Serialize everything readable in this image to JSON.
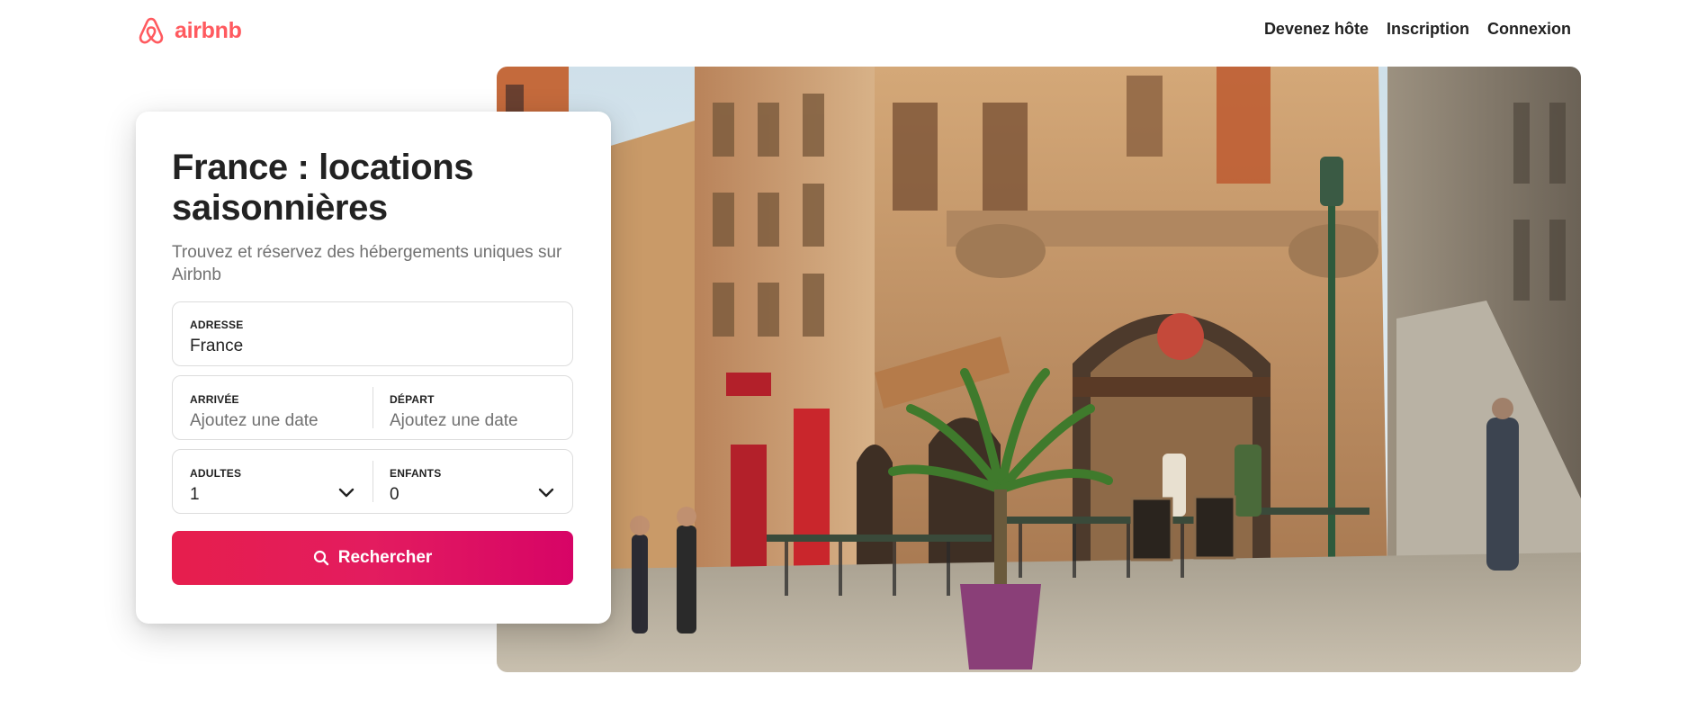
{
  "header": {
    "brand": "airbnb",
    "brand_color": "#FF5A5F",
    "nav": [
      {
        "label": "Devenez hôte"
      },
      {
        "label": "Inscription"
      },
      {
        "label": "Connexion"
      }
    ]
  },
  "search_card": {
    "title": "France : locations saisonnières",
    "subtitle": "Trouvez et réservez des hébergements uniques sur Airbnb",
    "address": {
      "label": "ADRESSE",
      "value": "France"
    },
    "checkin": {
      "label": "ARRIVÉE",
      "placeholder": "Ajoutez une date"
    },
    "checkout": {
      "label": "DÉPART",
      "placeholder": "Ajoutez une date"
    },
    "adults": {
      "label": "ADULTES",
      "value": "1"
    },
    "children": {
      "label": "ENFANTS",
      "value": "0"
    },
    "search_button": {
      "label": "Rechercher",
      "icon": "search-icon"
    },
    "button_color": "#E31C5F"
  },
  "hero": {
    "image": "photo of a café-restaurant terrace on a cobbled street corner"
  }
}
